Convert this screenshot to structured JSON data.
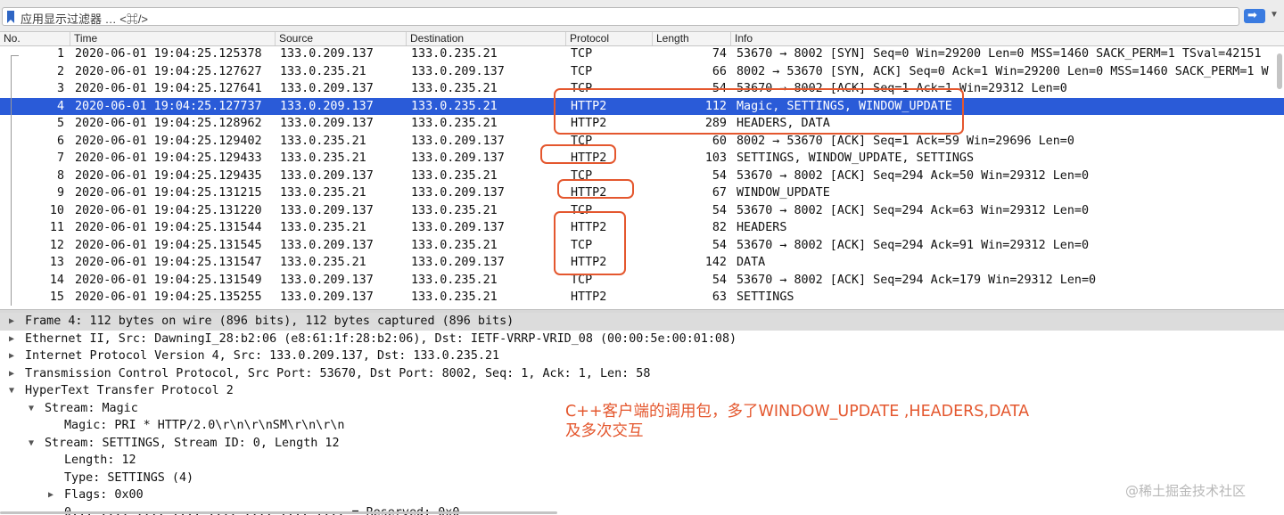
{
  "filter": {
    "placeholder": "应用显示过滤器 … <⌘/>"
  },
  "columns": [
    "No.",
    "Time",
    "Source",
    "Destination",
    "Protocol",
    "Length",
    "Info"
  ],
  "packets": [
    {
      "no": "1",
      "time": "2020-06-01 19:04:25.125378",
      "src": "133.0.209.137",
      "dst": "133.0.235.21",
      "proto": "TCP",
      "len": "74",
      "info": "53670 → 8002 [SYN] Seq=0 Win=29200 Len=0 MSS=1460 SACK_PERM=1 TSval=42151"
    },
    {
      "no": "2",
      "time": "2020-06-01 19:04:25.127627",
      "src": "133.0.235.21",
      "dst": "133.0.209.137",
      "proto": "TCP",
      "len": "66",
      "info": "8002 → 53670 [SYN, ACK] Seq=0 Ack=1 Win=29200 Len=0 MSS=1460 SACK_PERM=1 W"
    },
    {
      "no": "3",
      "time": "2020-06-01 19:04:25.127641",
      "src": "133.0.209.137",
      "dst": "133.0.235.21",
      "proto": "TCP",
      "len": "54",
      "info": "53670 → 8002 [ACK] Seq=1 Ack=1 Win=29312 Len=0"
    },
    {
      "no": "4",
      "time": "2020-06-01 19:04:25.127737",
      "src": "133.0.209.137",
      "dst": "133.0.235.21",
      "proto": "HTTP2",
      "len": "112",
      "info": "Magic, SETTINGS, WINDOW_UPDATE"
    },
    {
      "no": "5",
      "time": "2020-06-01 19:04:25.128962",
      "src": "133.0.209.137",
      "dst": "133.0.235.21",
      "proto": "HTTP2",
      "len": "289",
      "info": "HEADERS, DATA"
    },
    {
      "no": "6",
      "time": "2020-06-01 19:04:25.129402",
      "src": "133.0.235.21",
      "dst": "133.0.209.137",
      "proto": "TCP",
      "len": "60",
      "info": "8002 → 53670 [ACK] Seq=1 Ack=59 Win=29696 Len=0"
    },
    {
      "no": "7",
      "time": "2020-06-01 19:04:25.129433",
      "src": "133.0.235.21",
      "dst": "133.0.209.137",
      "proto": "HTTP2",
      "len": "103",
      "info": "SETTINGS, WINDOW_UPDATE, SETTINGS"
    },
    {
      "no": "8",
      "time": "2020-06-01 19:04:25.129435",
      "src": "133.0.209.137",
      "dst": "133.0.235.21",
      "proto": "TCP",
      "len": "54",
      "info": "53670 → 8002 [ACK] Seq=294 Ack=50 Win=29312 Len=0"
    },
    {
      "no": "9",
      "time": "2020-06-01 19:04:25.131215",
      "src": "133.0.235.21",
      "dst": "133.0.209.137",
      "proto": "HTTP2",
      "len": "67",
      "info": "WINDOW_UPDATE"
    },
    {
      "no": "10",
      "time": "2020-06-01 19:04:25.131220",
      "src": "133.0.209.137",
      "dst": "133.0.235.21",
      "proto": "TCP",
      "len": "54",
      "info": "53670 → 8002 [ACK] Seq=294 Ack=63 Win=29312 Len=0"
    },
    {
      "no": "11",
      "time": "2020-06-01 19:04:25.131544",
      "src": "133.0.235.21",
      "dst": "133.0.209.137",
      "proto": "HTTP2",
      "len": "82",
      "info": "HEADERS"
    },
    {
      "no": "12",
      "time": "2020-06-01 19:04:25.131545",
      "src": "133.0.209.137",
      "dst": "133.0.235.21",
      "proto": "TCP",
      "len": "54",
      "info": "53670 → 8002 [ACK] Seq=294 Ack=91 Win=29312 Len=0"
    },
    {
      "no": "13",
      "time": "2020-06-01 19:04:25.131547",
      "src": "133.0.235.21",
      "dst": "133.0.209.137",
      "proto": "HTTP2",
      "len": "142",
      "info": "DATA"
    },
    {
      "no": "14",
      "time": "2020-06-01 19:04:25.131549",
      "src": "133.0.209.137",
      "dst": "133.0.235.21",
      "proto": "TCP",
      "len": "54",
      "info": "53670 → 8002 [ACK] Seq=294 Ack=179 Win=29312 Len=0"
    },
    {
      "no": "15",
      "time": "2020-06-01 19:04:25.135255",
      "src": "133.0.209.137",
      "dst": "133.0.235.21",
      "proto": "HTTP2",
      "len": "63",
      "info": "SETTINGS"
    }
  ],
  "selected_packet": "4",
  "details": [
    {
      "text": "Frame 4: 112 bytes on wire (896 bits), 112 bytes captured (896 bits)",
      "state": "collapsed",
      "indent": 0,
      "highlight": true
    },
    {
      "text": "Ethernet II, Src: DawningI_28:b2:06 (e8:61:1f:28:b2:06), Dst: IETF-VRRP-VRID_08 (00:00:5e:00:01:08)",
      "state": "collapsed",
      "indent": 0
    },
    {
      "text": "Internet Protocol Version 4, Src: 133.0.209.137, Dst: 133.0.235.21",
      "state": "collapsed",
      "indent": 0
    },
    {
      "text": "Transmission Control Protocol, Src Port: 53670, Dst Port: 8002, Seq: 1, Ack: 1, Len: 58",
      "state": "collapsed",
      "indent": 0
    },
    {
      "text": "HyperText Transfer Protocol 2",
      "state": "expanded",
      "indent": 0
    },
    {
      "text": "Stream: Magic",
      "state": "expanded",
      "indent": 1
    },
    {
      "text": "Magic: PRI * HTTP/2.0\\r\\n\\r\\nSM\\r\\n\\r\\n",
      "state": "leaf",
      "indent": 2
    },
    {
      "text": "Stream: SETTINGS, Stream ID: 0, Length 12",
      "state": "expanded",
      "indent": 1
    },
    {
      "text": "Length: 12",
      "state": "leaf",
      "indent": 2
    },
    {
      "text": "Type: SETTINGS (4)",
      "state": "leaf",
      "indent": 2
    },
    {
      "text": "Flags: 0x00",
      "state": "collapsed",
      "indent": 2
    },
    {
      "text": "0... .... .... .... .... .... .... .... = Reserved: 0x0",
      "state": "leaf",
      "indent": 2
    }
  ],
  "annotation": {
    "line1": "C++客户端的调用包，多了WINDOW_UPDATE ,HEADERS,DATA",
    "line2": "及多次交互"
  },
  "watermark": "@稀土掘金技术社区",
  "colors": {
    "selection": "#2a5bd8",
    "annotation": "#e4572e"
  }
}
